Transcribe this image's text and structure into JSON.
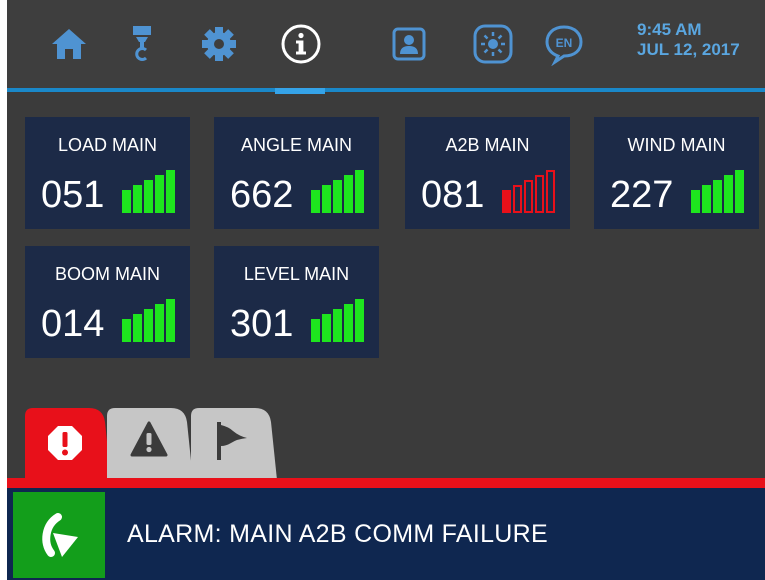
{
  "nav": {
    "items": [
      {
        "name": "home-icon"
      },
      {
        "name": "crane-hook-icon"
      },
      {
        "name": "gear-icon"
      },
      {
        "name": "info-icon",
        "active": true
      },
      {
        "name": "operator-id-icon"
      },
      {
        "name": "brightness-icon"
      },
      {
        "name": "language-icon",
        "text": "EN"
      }
    ],
    "time": "9:45 AM",
    "date": "JUL 12, 2017"
  },
  "tiles": [
    {
      "label": "LOAD MAIN",
      "value": "051",
      "signal_bars": 5,
      "status": "ok",
      "color": "#1ee51e"
    },
    {
      "label": "ANGLE MAIN",
      "value": "662",
      "signal_bars": 5,
      "status": "ok",
      "color": "#1ee51e"
    },
    {
      "label": "A2B MAIN",
      "value": "081",
      "signal_bars": 1,
      "status": "fault",
      "color": "#e8101a"
    },
    {
      "label": "WIND MAIN",
      "value": "227",
      "signal_bars": 5,
      "status": "ok",
      "color": "#1ee51e"
    },
    {
      "label": "BOOM MAIN",
      "value": "014",
      "signal_bars": 5,
      "status": "ok",
      "color": "#1ee51e"
    },
    {
      "label": "LEVEL MAIN",
      "value": "301",
      "signal_bars": 5,
      "status": "ok",
      "color": "#1ee51e"
    }
  ],
  "tabs": [
    {
      "name": "alarm-octagon-icon",
      "active": true
    },
    {
      "name": "warning-triangle-icon"
    },
    {
      "name": "flag-icon"
    }
  ],
  "alarm": {
    "message": "ALARM: MAIN A2B COMM FAILURE",
    "action_icon": "acknowledge-arrow-icon"
  },
  "colors": {
    "accent_blue": "#1a88c9",
    "ok_green": "#1ee51e",
    "alarm_red": "#e8101a",
    "tile_bg": "#1c2a47",
    "alarm_bg": "#0f2750"
  }
}
